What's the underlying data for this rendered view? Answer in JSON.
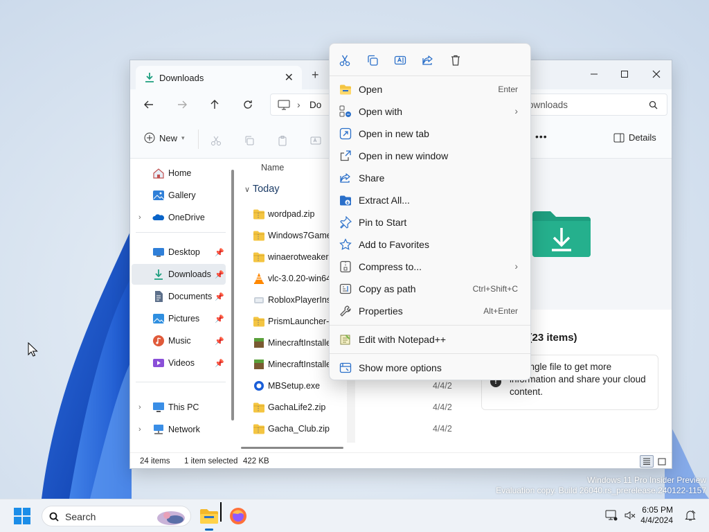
{
  "explorer": {
    "tab_title": "Downloads",
    "tab_close": "✕",
    "new_tab": "+",
    "address_crumb": "Do",
    "search_placeholder": "ownloads",
    "commands": {
      "new_label": "New",
      "more": "•••",
      "details_label": "Details"
    },
    "sidebar": {
      "items": [
        {
          "label": "Home",
          "icon": "home-icon"
        },
        {
          "label": "Gallery",
          "icon": "gallery-icon"
        },
        {
          "label": "OneDrive",
          "icon": "onedrive-icon"
        },
        {
          "label": "Desktop",
          "icon": "desktop-icon"
        },
        {
          "label": "Downloads",
          "icon": "downloads-icon"
        },
        {
          "label": "Documents",
          "icon": "documents-icon"
        },
        {
          "label": "Pictures",
          "icon": "pictures-icon"
        },
        {
          "label": "Music",
          "icon": "music-icon"
        },
        {
          "label": "Videos",
          "icon": "videos-icon"
        },
        {
          "label": "This PC",
          "icon": "this-pc-icon"
        },
        {
          "label": "Network",
          "icon": "network-icon"
        }
      ]
    },
    "file_list": {
      "column_name": "Name",
      "group_label": "Today",
      "files": [
        {
          "name": "wordpad.zip",
          "date": "",
          "icon": "zip-folder-icon"
        },
        {
          "name": "Windows7Games",
          "date": "",
          "icon": "zip-folder-icon"
        },
        {
          "name": "winaerotweaker.z",
          "date": "",
          "icon": "zip-folder-icon"
        },
        {
          "name": "vlc-3.0.20-win64.",
          "date": "",
          "icon": "vlc-icon"
        },
        {
          "name": "RobloxPlayerInsta",
          "date": "",
          "icon": "roblox-icon"
        },
        {
          "name": "PrismLauncher-W",
          "date": "",
          "icon": "zip-folder-icon"
        },
        {
          "name": "MinecraftInstalle",
          "date": "",
          "icon": "minecraft-icon"
        },
        {
          "name": "MinecraftInstalle",
          "date": "",
          "icon": "minecraft-icon"
        },
        {
          "name": "MBSetup.exe",
          "date": "4/4/2",
          "icon": "malwarebytes-icon"
        },
        {
          "name": "GachaLife2.zip",
          "date": "4/4/2",
          "icon": "zip-folder-icon"
        },
        {
          "name": "Gacha_Club.zip",
          "date": "4/4/2",
          "icon": "zip-folder-icon"
        }
      ]
    },
    "details_pane": {
      "title_fragment": "s (23 items)",
      "info_text": "t a single file to get more information and share your cloud content."
    },
    "status": {
      "items": "24 items",
      "selected": "1 item selected",
      "size": "422 KB"
    }
  },
  "context_menu": {
    "quick_actions": [
      "cut-icon",
      "copy-icon",
      "rename-icon",
      "share-icon",
      "delete-icon"
    ],
    "items": [
      {
        "label": "Open",
        "shortcut": "Enter",
        "icon": "open-icon"
      },
      {
        "label": "Open with",
        "shortcut": "",
        "submenu": "›",
        "icon": "open-with-icon"
      },
      {
        "label": "Open in new tab",
        "shortcut": "",
        "icon": "new-tab-icon"
      },
      {
        "label": "Open in new window",
        "shortcut": "",
        "icon": "new-window-icon"
      },
      {
        "label": "Share",
        "shortcut": "",
        "icon": "share-icon"
      },
      {
        "label": "Extract All...",
        "shortcut": "",
        "icon": "extract-icon"
      },
      {
        "label": "Pin to Start",
        "shortcut": "",
        "icon": "pin-icon"
      },
      {
        "label": "Add to Favorites",
        "shortcut": "",
        "icon": "star-icon"
      },
      {
        "label": "Compress to...",
        "shortcut": "",
        "submenu": "›",
        "icon": "compress-icon"
      },
      {
        "label": "Copy as path",
        "shortcut": "Ctrl+Shift+C",
        "icon": "copy-path-icon"
      },
      {
        "label": "Properties",
        "shortcut": "Alt+Enter",
        "icon": "properties-icon"
      }
    ],
    "notepad_item": "Edit with Notepad++",
    "more_options": "Show more options"
  },
  "taskbar": {
    "search_label": "Search",
    "time": "6:05 PM",
    "date": "4/4/2024"
  },
  "watermark": {
    "line1": "Windows 11 Pro Insider Preview",
    "line2": "Evaluation copy. Build 26040.rs_prerelease.240122-1157"
  },
  "colors": {
    "accent": "#0067c0",
    "folder_yellow": "#f4c542",
    "downloads_green": "#1e9e7f"
  }
}
